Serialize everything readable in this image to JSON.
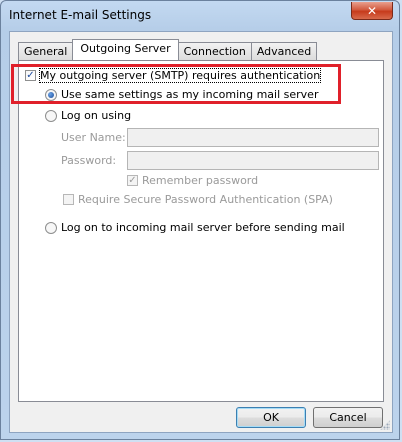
{
  "window": {
    "title": "Internet E-mail Settings",
    "close_glyph": "✕"
  },
  "tabs": [
    {
      "label": "General",
      "active": false
    },
    {
      "label": "Outgoing Server",
      "active": true
    },
    {
      "label": "Connection",
      "active": false
    },
    {
      "label": "Advanced",
      "active": false
    }
  ],
  "outgoing": {
    "requires_auth": {
      "label": "My outgoing server (SMTP) requires authentication",
      "checked": true
    },
    "use_same": {
      "label": "Use same settings as my incoming mail server",
      "selected": true
    },
    "log_on_using": {
      "label": "Log on using",
      "selected": false
    },
    "user_name": {
      "label": "User Name:",
      "value": ""
    },
    "password": {
      "label": "Password:",
      "value": ""
    },
    "remember_password": {
      "label": "Remember password",
      "checked": true,
      "enabled": false
    },
    "spa": {
      "label": "Require Secure Password Authentication (SPA)",
      "checked": false,
      "enabled": false
    },
    "log_on_incoming": {
      "label": "Log on to incoming mail server before sending mail",
      "selected": false
    }
  },
  "buttons": {
    "ok": "OK",
    "cancel": "Cancel"
  },
  "colors": {
    "highlight": "#e0202a",
    "accent": "#1c4c9a"
  },
  "icons": {
    "check": "✓",
    "close": "close-icon",
    "grip": "resize-grip-icon"
  }
}
